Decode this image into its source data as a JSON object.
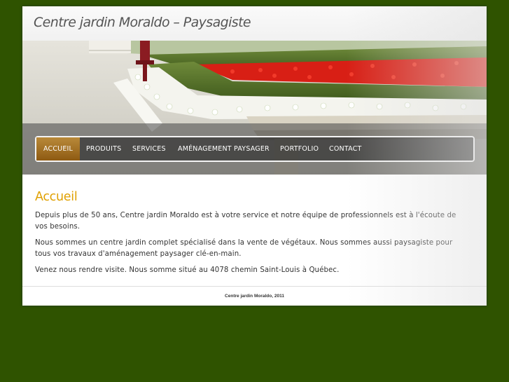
{
  "header": {
    "site_title": "Centre jardin Moraldo – Paysagiste"
  },
  "nav": {
    "items": [
      {
        "label": "ACCUEIL",
        "active": true
      },
      {
        "label": "PRODUITS",
        "active": false
      },
      {
        "label": "SERVICES",
        "active": false
      },
      {
        "label": "AMÉNAGEMENT PAYSAGER",
        "active": false
      },
      {
        "label": "PORTFOLIO",
        "active": false
      },
      {
        "label": "CONTACT",
        "active": false
      }
    ]
  },
  "main": {
    "heading": "Accueil",
    "paragraphs": [
      "Depuis plus de 50 ans, Centre jardin Moraldo est à votre service et notre équipe de professionnels est à l'écoute de vos besoins.",
      "Nous sommes un centre jardin complet spécialisé dans la vente de végétaux. Nous sommes aussi paysagiste pour tous vos travaux d'aménagement paysager clé-en-main.",
      "Venez nous rendre visite. Nous somme situé au 4078 chemin Saint-Louis à Québec."
    ]
  },
  "footer": {
    "text": "Centre jardin Moraldo, 2011"
  },
  "colors": {
    "page_background": "#2f5300",
    "heading": "#e0a000",
    "nav_active": "#9b6a1e"
  }
}
